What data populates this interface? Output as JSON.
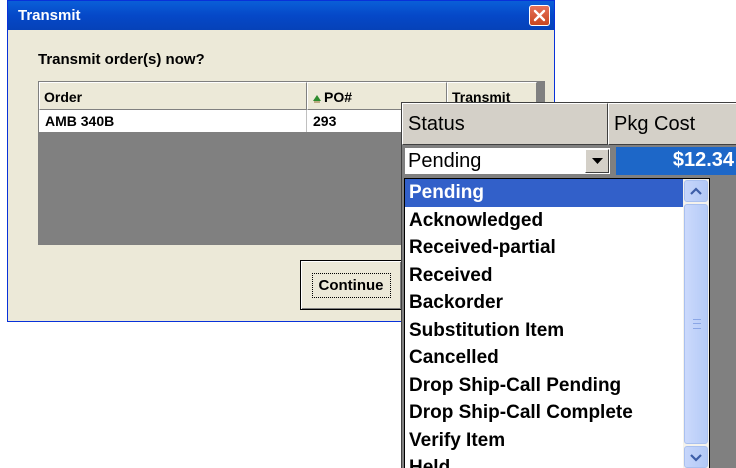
{
  "dialog": {
    "title": "Transmit",
    "prompt": "Transmit order(s) now?",
    "continue_label": "Continue",
    "columns": [
      "Order",
      "PO#",
      "Transmit"
    ],
    "rows": [
      {
        "order": "AMB 340B",
        "po": "293"
      }
    ]
  },
  "panel": {
    "columns": [
      "Status",
      "Pkg Cost"
    ],
    "status_value": "Pending",
    "pkg_cost": "$12.34",
    "options": [
      "Pending",
      "Acknowledged",
      "Received-partial",
      "Received",
      "Backorder",
      "Substitution Item",
      "Cancelled",
      "Drop Ship-Call Pending",
      "Drop Ship-Call Complete",
      "Verify Item",
      "Held"
    ],
    "selected_index": 0
  },
  "colors": {
    "titlebar": "#0548c8",
    "selection": "#3260c9",
    "cost_bg": "#1d67c8",
    "close_button": "#c9461f"
  },
  "icons": [
    "close-icon",
    "sort-icon",
    "dropdown-arrow-icon",
    "scroll-up-icon",
    "scroll-down-icon"
  ]
}
